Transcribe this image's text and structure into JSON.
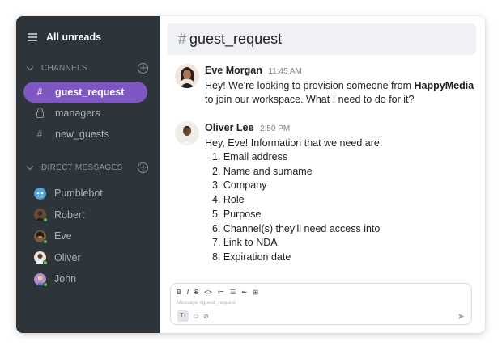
{
  "sidebar": {
    "title": "All unreads",
    "channels_header": "CHANNELS",
    "channels": [
      {
        "glyph": "#",
        "label": "guest_request",
        "active": true
      },
      {
        "glyph": "lock",
        "label": "managers",
        "active": false
      },
      {
        "glyph": "#",
        "label": "new_guests",
        "active": false
      }
    ],
    "dm_header": "DIRECT MESSAGES",
    "dms": [
      {
        "label": "Pumblebot",
        "icon": "bot-avatar",
        "color": "#4fa3d9"
      },
      {
        "label": "Robert",
        "icon": "user-avatar",
        "color": "#6b4a3a"
      },
      {
        "label": "Eve",
        "icon": "user-avatar",
        "color": "#7a5a3c"
      },
      {
        "label": "Oliver",
        "icon": "user-avatar",
        "color": "#d9c9b8"
      },
      {
        "label": "John",
        "icon": "user-avatar",
        "color": "#b68ec4"
      }
    ]
  },
  "channel": {
    "hash": "#",
    "name": "guest_request"
  },
  "messages": [
    {
      "author": "Eve Morgan",
      "time": "11:45 AM",
      "text_before": "Hey! We're looking to provision someone from ",
      "text_bold": "HappyMedia",
      "text_after": "to join our workspace. What I need to do for it?"
    },
    {
      "author": "Oliver Lee",
      "time": "2:50 PM",
      "text": "Hey, Eve! Information that we need are:",
      "list": [
        "1. Email address",
        "2. Name and surname",
        "3. Company",
        "4. Role",
        "5. Purpose",
        "6. Channel(s) they'll need access into",
        "7. Link to NDA",
        "8. Expiration date"
      ]
    }
  ],
  "composer": {
    "placeholder": "Message #guest_request",
    "format_buttons": [
      "B",
      "I",
      "S",
      "<>",
      "≔",
      "☰",
      "⇤",
      "⊞"
    ],
    "text_button": "Tт"
  },
  "colors": {
    "sidebar_bg": "#2d343a",
    "active_channel": "#7e57c2",
    "online": "#52c152"
  }
}
